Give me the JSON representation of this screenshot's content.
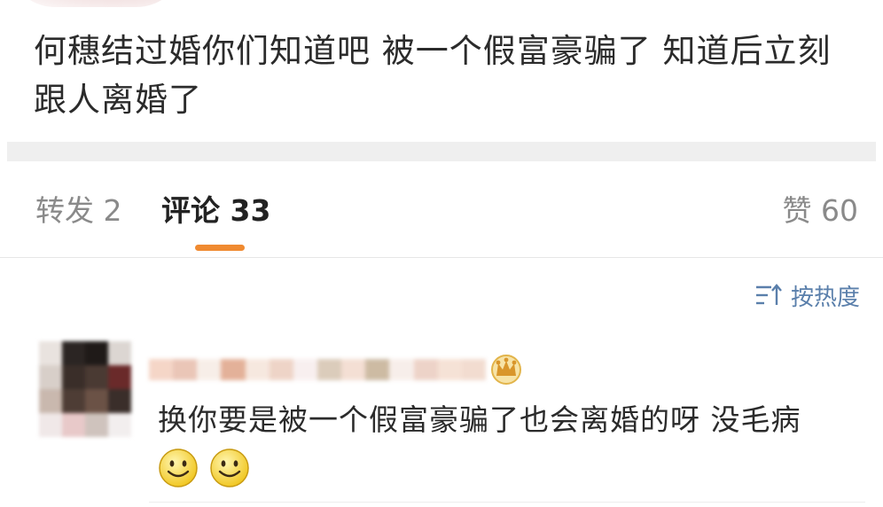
{
  "post": {
    "text": "何穗结过婚你们知道吧  被一个假富豪骗了  知道后立刻跟人离婚了"
  },
  "tabs": {
    "repost": "转发 2",
    "comments": "评论 33",
    "likes": "赞 60"
  },
  "sort": {
    "label": "按热度",
    "icon": "sort-icon"
  },
  "comment": {
    "text": "换你要是被一个假富豪骗了也会离婚的呀 没毛病",
    "badge_icon": "crown-icon",
    "emojis": [
      "smile-icon",
      "smile-icon"
    ]
  },
  "colors": {
    "accent": "#f08a30",
    "link": "#5a7fab",
    "muted_text": "#8a8a8a",
    "divider": "#efefef"
  }
}
